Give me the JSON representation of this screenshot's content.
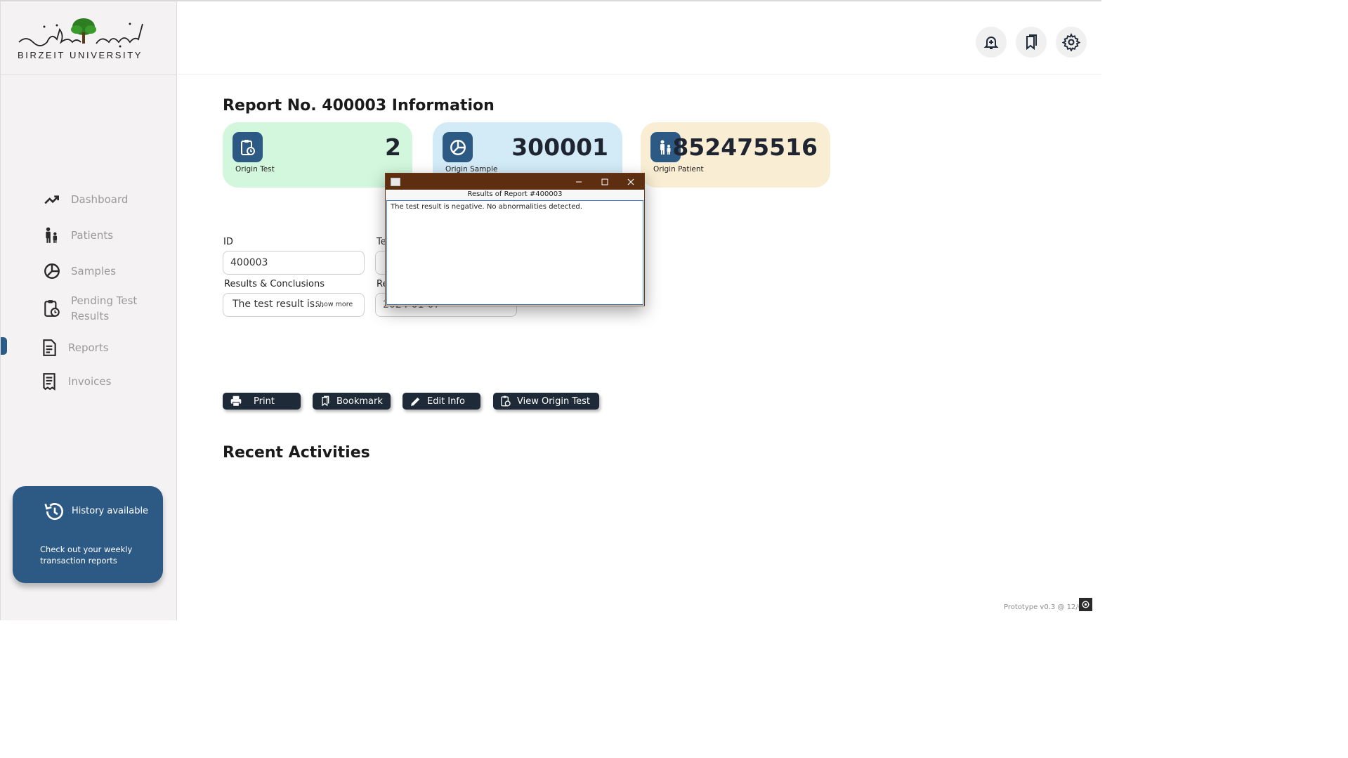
{
  "sidebar": {
    "logo_text": "BIRZEIT UNIVERSITY",
    "logo_arabic": "جامعة بيرزيت",
    "items": [
      {
        "label": "Dashboard",
        "icon": "trending-up-icon"
      },
      {
        "label": "Patients",
        "icon": "patients-icon"
      },
      {
        "label": "Samples",
        "icon": "samples-icon"
      },
      {
        "label": "Pending Test Results",
        "icon": "clipboard-clock-icon"
      },
      {
        "label": "Reports",
        "icon": "report-icon",
        "active": true
      },
      {
        "label": "Invoices",
        "icon": "invoice-icon"
      }
    ],
    "history_card": {
      "title": "History available",
      "description": "Check out your weekly transaction reports"
    }
  },
  "header": {
    "buttons": [
      "bell-icon",
      "bookmark-icon",
      "gear-icon"
    ]
  },
  "page": {
    "title": "Report No. 400003 Information",
    "cards": [
      {
        "label": "Origin Test",
        "value": "2",
        "color": "#d2f7dc"
      },
      {
        "label": "Origin Sample",
        "value": "300001",
        "color": "#d3ebf7"
      },
      {
        "label": "Origin Patient",
        "value": "852475516",
        "color": "#f9eed3"
      }
    ],
    "fields": {
      "id_label": "ID",
      "id_value": "400003",
      "test_label_partial": "Te",
      "results_label": "Results & Conclusions",
      "results_value": "The test result is...",
      "show_more": "Show more",
      "report_date_label_partial": "Re",
      "report_date_value": "2024-01-07"
    },
    "actions": {
      "print": "Print",
      "bookmark": "Bookmark",
      "edit": "Edit Info",
      "view_origin": "View Origin Test"
    },
    "recent_title": "Recent Activities",
    "footer": "Prototype v0.3 @ 12/05/"
  },
  "popup": {
    "heading": "Results of Report #400003",
    "text": "The test result is negative. No abnormalities detected."
  },
  "colors": {
    "accent": "#2c5a85",
    "button_dark": "#1f2a38",
    "popup_titlebar": "#5e2e11"
  }
}
